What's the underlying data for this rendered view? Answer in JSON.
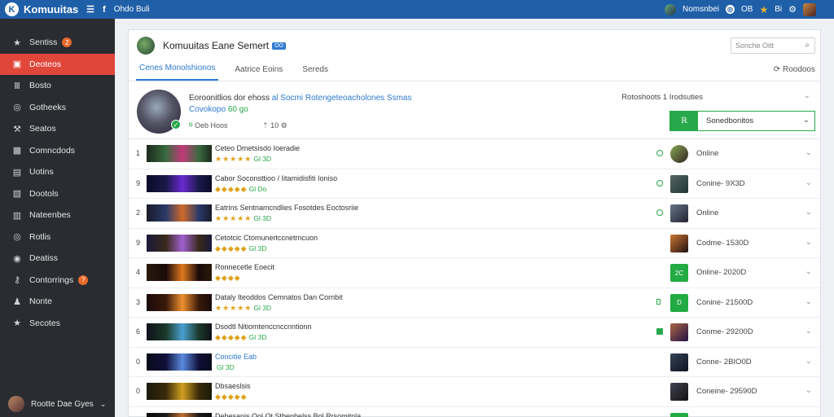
{
  "topbar": {
    "app_name": "Komuuitas",
    "link1": "Ohdo Buli",
    "user": "Nomsnbei",
    "count1": "OB",
    "count2": "Bi"
  },
  "sidebar": {
    "items": [
      {
        "label": "Sentiss",
        "icon": "star-icon",
        "badge": "2"
      },
      {
        "label": "Deoteos",
        "icon": "folder-icon",
        "active": true
      },
      {
        "label": "Bosto",
        "icon": "bars-icon"
      },
      {
        "label": "Gotheeks",
        "icon": "globe-icon"
      },
      {
        "label": "Seatos",
        "icon": "wrench-icon"
      },
      {
        "label": "Comncdods",
        "icon": "image-icon"
      },
      {
        "label": "Uotins",
        "icon": "document-icon"
      },
      {
        "label": "Dootols",
        "icon": "gallery-icon"
      },
      {
        "label": "Nateenbes",
        "icon": "clipboard-icon"
      },
      {
        "label": "Rotlis",
        "icon": "globe-icon"
      },
      {
        "label": "Deatiss",
        "icon": "camera-icon"
      },
      {
        "label": "Contorrings",
        "icon": "key-icon",
        "badge": "?"
      },
      {
        "label": "Nonte",
        "icon": "user-icon"
      },
      {
        "label": "Secotes",
        "icon": "star-icon"
      }
    ],
    "user_name": "Rootte Dae Gyes"
  },
  "panel": {
    "title": "Komuuitas Eane Semert",
    "tag": "OO",
    "search_placeholder": "Sonche Oitt",
    "tabs": [
      "Cenes Monolshionos",
      "Aatrice Eoins",
      "Sereds"
    ],
    "tab_action": "Roodoos"
  },
  "featured": {
    "title": "Eoroonitlios dor ehoss",
    "title_highlight": "al Socmi Rotengeteoacholones Ssmas",
    "subtitle": "Covokopo",
    "subtitle_green": "60 go",
    "meta_label": "Oeb Hoos",
    "meta_count": "10",
    "right_label": "Rotoshoots 1 Irodsuties",
    "action_label": "Sonedbonitos"
  },
  "rows": [
    {
      "num": "1",
      "title": "Ceteo Dmetsisdo Ioeradie",
      "rating": "★★★★★",
      "count": "Gl 3D",
      "status": "Online",
      "dot": "ring",
      "thumb": [
        "#3a6b3f",
        "#c23a7a",
        "#1c2a1c"
      ],
      "av": [
        "#8a5",
        "#322"
      ],
      "round": true
    },
    {
      "num": "9",
      "title": "Cabor Soconsttioo / Iitamidisfiti Ioniso",
      "rating": "◆◆◆◆◆",
      "count": "Gl Do",
      "status": "Conine- 9X3D",
      "dot": "ring",
      "thumb": [
        "#1a1a4a",
        "#6a2ad0",
        "#0a0a2a"
      ],
      "av": [
        "#566",
        "#233"
      ]
    },
    {
      "num": "2",
      "title": "Eatrins Sentnamcndlies Fosotdes Eoctosriie",
      "rating": "★★★★★",
      "count": "Gl 3D",
      "status": "Online",
      "dot": "ring",
      "thumb": [
        "#2a3a6a",
        "#d06a2a",
        "#1a1a2a"
      ],
      "av": [
        "#678",
        "#223"
      ]
    },
    {
      "num": "9",
      "title": "Cetotcic Ctomunertccnetrncuon",
      "rating": "◆◆◆◆◆",
      "count": "Gl 3D",
      "status": "Codme- 1530D",
      "dot": "none",
      "thumb": [
        "#3a2a1a",
        "#a060d0",
        "#1a1a3a"
      ],
      "av": [
        "#c73",
        "#211"
      ]
    },
    {
      "num": "4",
      "title": "Ronnecetle Eoecit",
      "rating": "◆◆◆◆",
      "count": "",
      "status": "Online- 2020D",
      "dot": "none",
      "thumb": [
        "#1a0a0a",
        "#e07a20",
        "#2a1a0a"
      ],
      "av": [
        "#2a4",
        "#2a4"
      ],
      "avtext": "2C"
    },
    {
      "num": "3",
      "title": "Dataly Iteoddos Cemnatos Dan Cornbit",
      "rating": "★★★★★",
      "count": "Gl 3D",
      "status": "Conine- 21500D",
      "dot": "small",
      "thumb": [
        "#3a1a0a",
        "#f09030",
        "#1a0a0a"
      ],
      "av": [
        "#2a4",
        "#2a4"
      ],
      "avtext": "D"
    },
    {
      "num": "6",
      "title": "Dsodtl Nitiomtenccnccnntionn",
      "rating": "◆◆◆◆◆",
      "count": "Gl 3D",
      "status": "Conme- 29200D",
      "dot": "fill",
      "thumb": [
        "#1a3a2a",
        "#4aa0d0",
        "#10101a"
      ],
      "av": [
        "#a64",
        "#214"
      ]
    },
    {
      "num": "0",
      "title": "Concitie Eab",
      "title_blue": true,
      "rating": "",
      "count": "Gl 3D",
      "status": "Conne- 2BIO0D",
      "dot": "none",
      "thumb": [
        "#10103a",
        "#5a8ae0",
        "#0a0a1a"
      ],
      "av": [
        "#345",
        "#112"
      ]
    },
    {
      "num": "0",
      "title": "Dbsaeslsis",
      "rating": "◆◆◆◆◆",
      "count": "",
      "status": "Coneine- 29590D",
      "dot": "none",
      "thumb": [
        "#3a2a0a",
        "#d0a020",
        "#1a1a0a"
      ],
      "av": [
        "#445",
        "#111"
      ]
    },
    {
      "num": "0",
      "title": "Debesanis Ool Ot Stbenbelss Bol Rrsomitnla",
      "rating": "◆◆◆",
      "count": "",
      "status": "",
      "dot": "none",
      "thumb": [
        "#1a1a1a",
        "#c07030",
        "#0a0a0a"
      ],
      "av": [
        "#2a4",
        "#2a4"
      ]
    }
  ]
}
